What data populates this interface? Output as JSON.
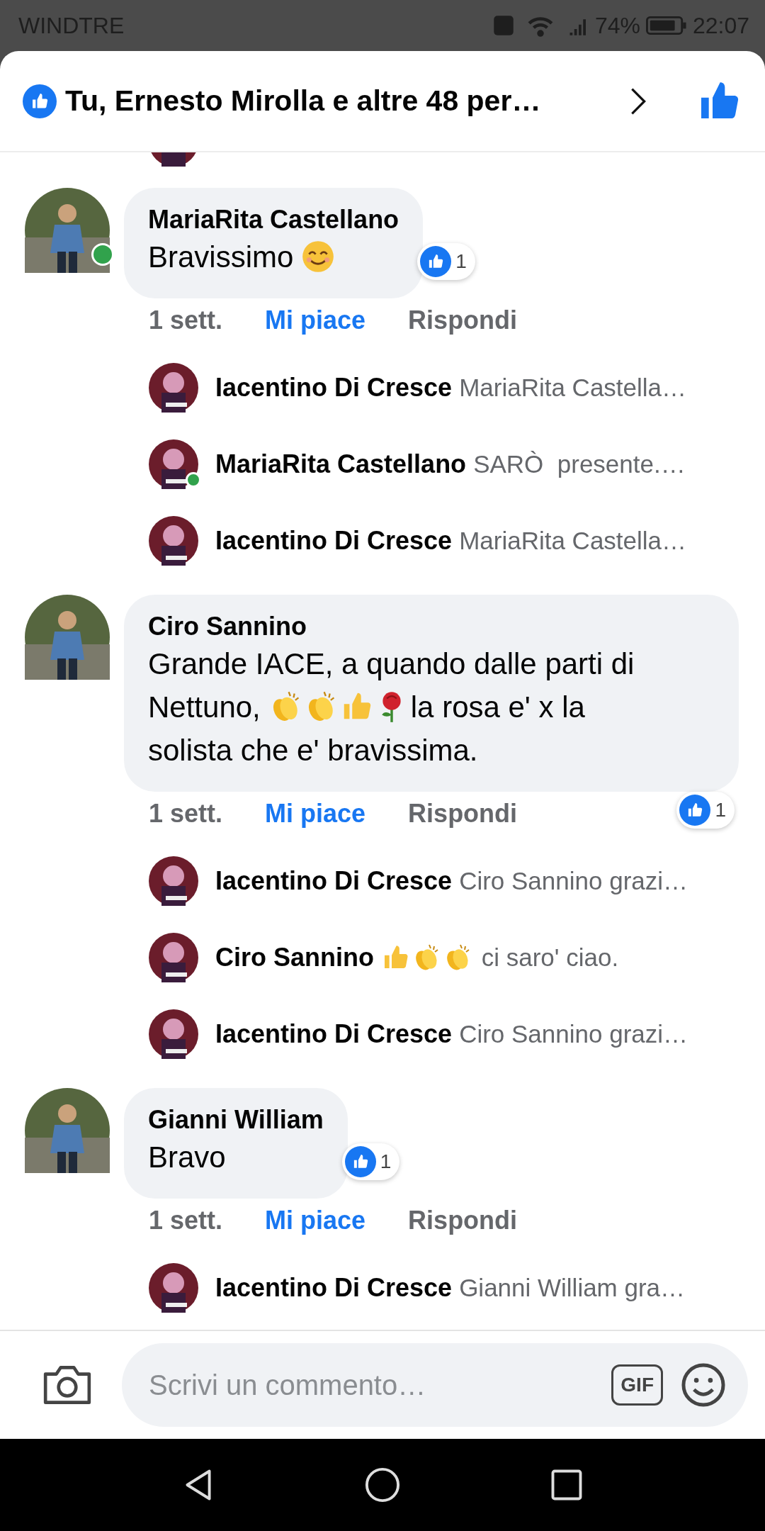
{
  "status_bar": {
    "carrier": "WINDTRE",
    "battery": "74%",
    "time": "22:07"
  },
  "header": {
    "title": "Tu, Ernesto Mirolla e altre 48 per…"
  },
  "comments": [
    {
      "author": "MariaRita Castellano",
      "online": true,
      "message": [
        {
          "kind": "text",
          "text": "Bravissimo"
        },
        {
          "kind": "smile"
        }
      ],
      "reactions": "1",
      "time": "1 sett.",
      "like": "Mi piace",
      "liked": true,
      "reply": "Rispondi",
      "replies": [
        {
          "author": "Iacentino Di Cresce",
          "online": false,
          "parts": [
            {
              "kind": "text",
              "text": "MariaRita Castella…"
            }
          ]
        },
        {
          "author": "MariaRita Castellano",
          "online": true,
          "parts": [
            {
              "kind": "text",
              "text": "SARÒ  presente.…"
            }
          ]
        },
        {
          "author": "Iacentino Di Cresce",
          "online": false,
          "parts": [
            {
              "kind": "text",
              "text": "MariaRita Castella…"
            }
          ]
        }
      ]
    },
    {
      "author": "Ciro Sannino",
      "online": false,
      "message": [
        {
          "kind": "text",
          "text": "Grande IACE, a quando dalle parti di"
        },
        {
          "kind": "text",
          "text": "Nettuno,"
        },
        {
          "kind": "clap"
        },
        {
          "kind": "clap"
        },
        {
          "kind": "thumbsup"
        },
        {
          "kind": "rose"
        },
        {
          "kind": "text",
          "text": "la rosa e' x la"
        },
        {
          "kind": "text",
          "text": "solista che e' bravissima."
        }
      ],
      "reactions": "1",
      "time": "1 sett.",
      "like": "Mi piace",
      "liked": true,
      "reply": "Rispondi",
      "replies": [
        {
          "author": "Iacentino Di Cresce",
          "online": false,
          "parts": [
            {
              "kind": "text",
              "text": "Ciro Sannino grazi…"
            }
          ]
        },
        {
          "author": "Ciro Sannino",
          "online": false,
          "parts": [
            {
              "kind": "thumbsup"
            },
            {
              "kind": "clap"
            },
            {
              "kind": "clap"
            },
            {
              "kind": "text",
              "text": " ci saro' ciao."
            }
          ]
        },
        {
          "author": "Iacentino Di Cresce",
          "online": false,
          "parts": [
            {
              "kind": "text",
              "text": "Ciro Sannino grazi…"
            }
          ]
        }
      ]
    },
    {
      "author": "Gianni William",
      "online": false,
      "message": [
        {
          "kind": "text",
          "text": "Bravo"
        }
      ],
      "reactions": "1",
      "time": "1 sett.",
      "like": "Mi piace",
      "liked": true,
      "reply": "Rispondi",
      "replies": [
        {
          "author": "Iacentino Di Cresce",
          "online": false,
          "parts": [
            {
              "kind": "text",
              "text": "Gianni William gra…"
            }
          ]
        }
      ]
    }
  ],
  "composer": {
    "placeholder": "Scrivi un commento…",
    "gif_label": "GIF"
  }
}
